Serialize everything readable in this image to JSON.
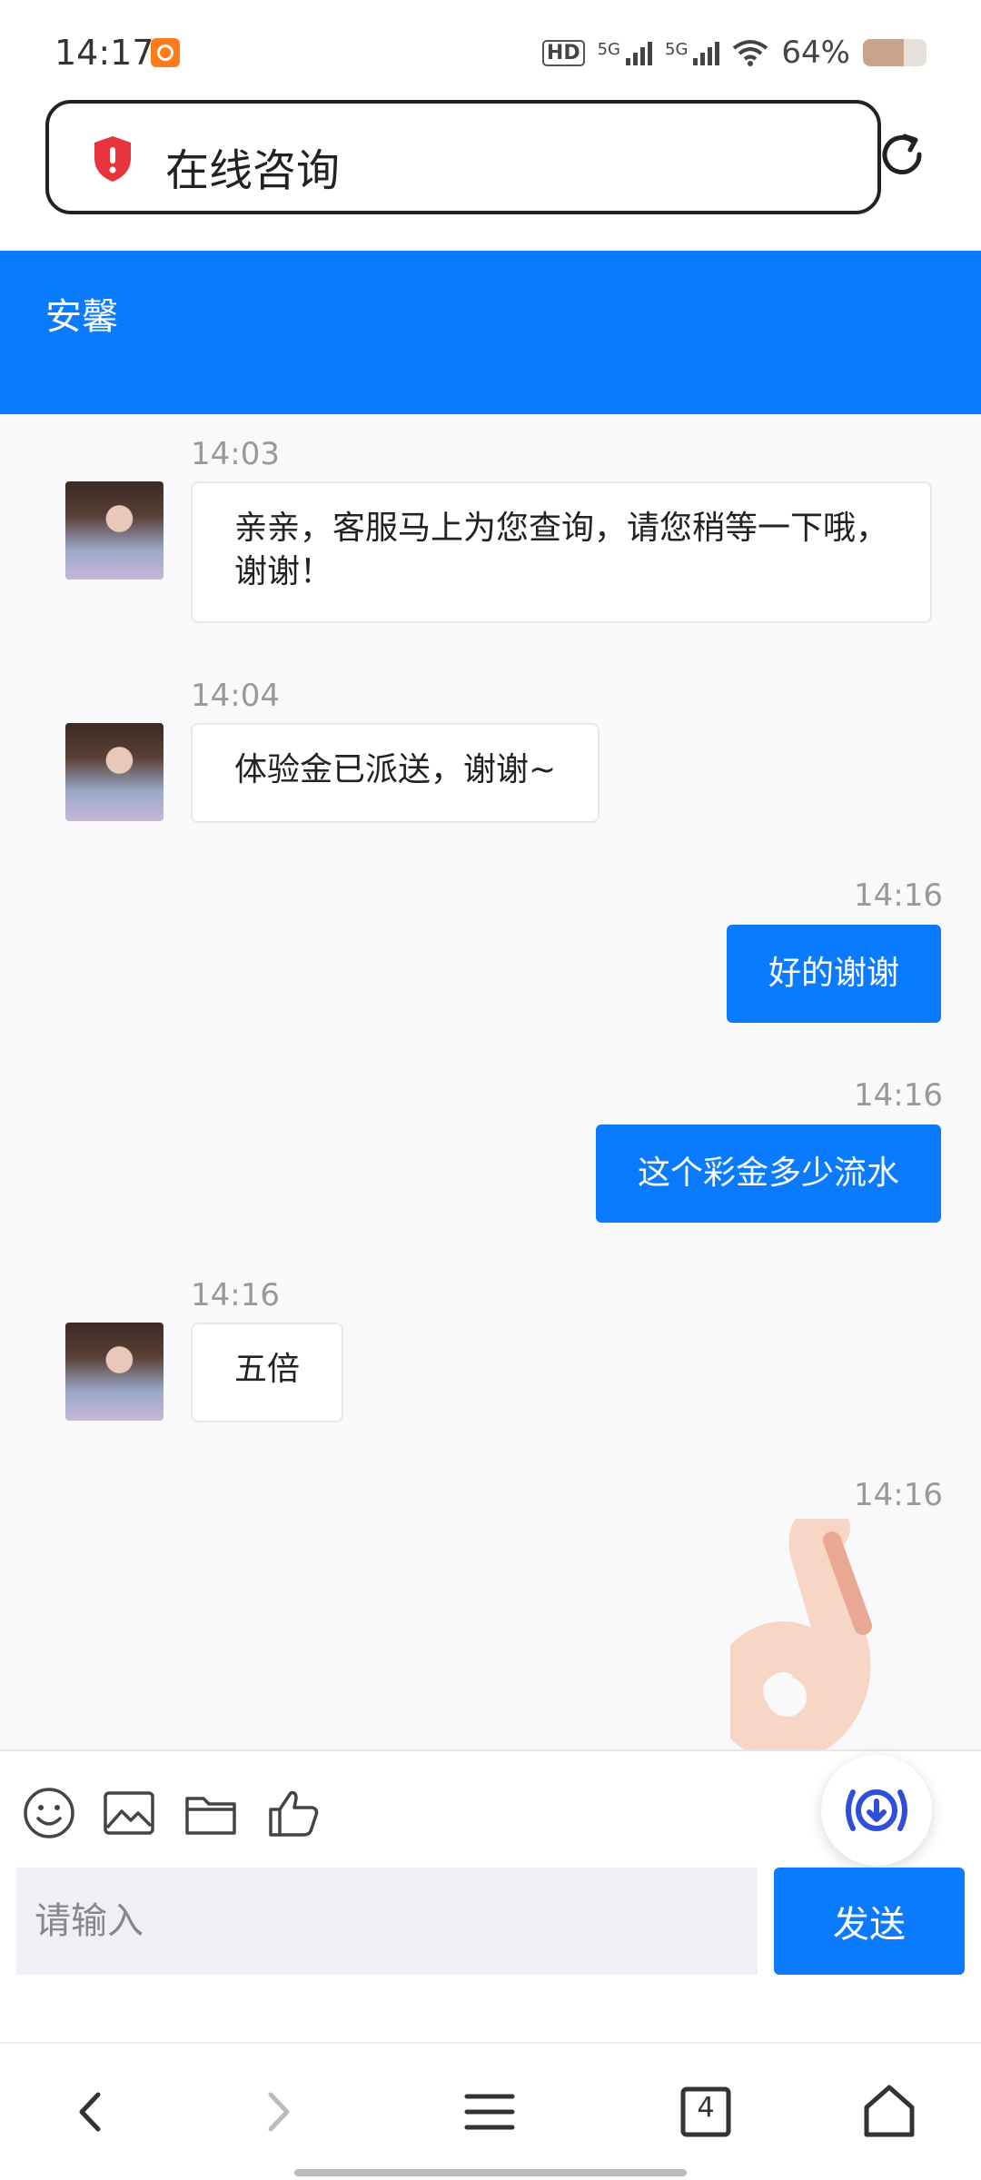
{
  "status_bar": {
    "time": "14:17",
    "hd_label": "HD",
    "network_1": "5G",
    "network_2": "5G",
    "battery": "64%",
    "battery_level": 0.64
  },
  "address_bar": {
    "title": "在线咨询"
  },
  "chat_header": {
    "agent_name": "安馨"
  },
  "messages": [
    {
      "side": "in",
      "time": "14:03",
      "text": "亲亲，客服马上为您查询，请您稍等一下哦，谢谢！"
    },
    {
      "side": "in",
      "time": "14:04",
      "text": "体验金已派送，谢谢~"
    },
    {
      "side": "out",
      "time": "14:16",
      "text": "好的谢谢"
    },
    {
      "side": "out",
      "time": "14:16",
      "text": "这个彩金多少流水"
    },
    {
      "side": "in",
      "time": "14:16",
      "text": "五倍"
    },
    {
      "side": "out",
      "time": "14:16",
      "text": "",
      "sticker": "ok-hand-icon"
    }
  ],
  "input": {
    "placeholder": "请输入",
    "send_label": "发送"
  },
  "nav": {
    "tab_count": "4"
  },
  "colors": {
    "accent": "#0a7aff",
    "chat_bg": "#f9f9fb"
  }
}
